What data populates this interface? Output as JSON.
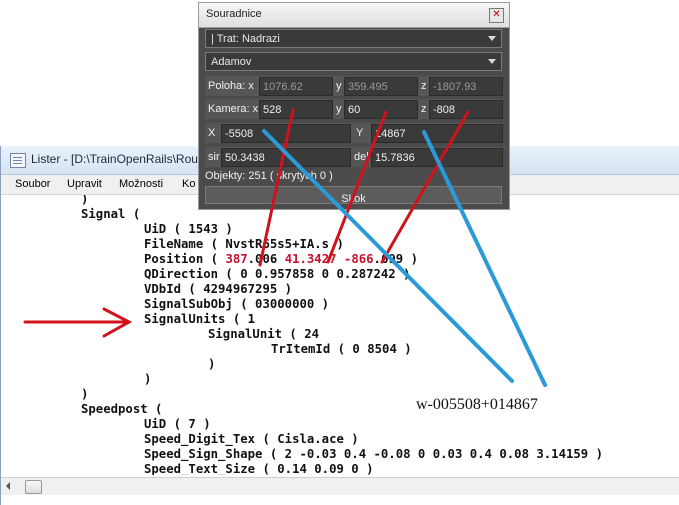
{
  "lister": {
    "title": "Lister - [D:\\TrainOpenRails\\Rout",
    "menu": [
      "Soubor",
      "Upravit",
      "Možnosti",
      "Ko"
    ],
    "lines": [
      [
        ")"
      ],
      [
        "Signal ("
      ],
      [
        "UiD ( 1543 )"
      ],
      [
        "FileName ( NvstR65s5+IA.s )"
      ],
      [
        "Position ( ",
        {
          "hl": "387"
        },
        ".006 ",
        {
          "hl": "41.3427"
        },
        " ",
        {
          "hl": "-866"
        },
        ".699 )"
      ],
      [
        "QDirection ( 0 0.957858 0 0.287242 )"
      ],
      [
        "VDbId ( 4294967295 )"
      ],
      [
        "SignalSubObj ( 03000000 )"
      ],
      [
        "SignalUnits ( 1"
      ],
      [
        "SignalUnit ( 24"
      ],
      [
        "TrItemId ( 0 8504 )"
      ],
      [
        ")"
      ],
      [
        ")"
      ],
      [
        ")"
      ],
      [
        "Speedpost ("
      ],
      [
        "UiD ( 7 )"
      ],
      [
        "Speed_Digit_Tex ( Cisla.ace )"
      ],
      [
        "Speed_Sign_Shape ( 2 -0.03 0.4 -0.08 0 0.03 0.4 0.08 3.14159 )"
      ],
      [
        "Speed_Text_Size ( 0.14 0.09 0 )"
      ]
    ]
  },
  "dialog": {
    "title": "Souradnice",
    "close_glyph": "✕",
    "trat_combo": "| Trat:  Nadrazi",
    "station_combo": "Adamov",
    "poloha": {
      "label": "Poloha:  x",
      "x": "1076.62",
      "y_label": "y",
      "y": "359.495",
      "z_label": "z",
      "z": "-1807.93"
    },
    "kamera": {
      "label": "Kamera: x",
      "x": "528",
      "y_label": "y",
      "y": "60",
      "z_label": "z",
      "z": "-808"
    },
    "xy": {
      "x_label": "X",
      "x": "-5508",
      "y_label": "Y",
      "y": "14867"
    },
    "sir_del": {
      "sir_label": "sir",
      "sir": "50.3438",
      "del_label": "del",
      "del": "15.7836"
    },
    "objekty": "Objekty: 251  ( skrytych 0 )",
    "skok_button": "Skok"
  },
  "annotation": {
    "text": "w-005508+014867",
    "red_color": "#d0121b",
    "blue_color": "#2a9ad8"
  }
}
